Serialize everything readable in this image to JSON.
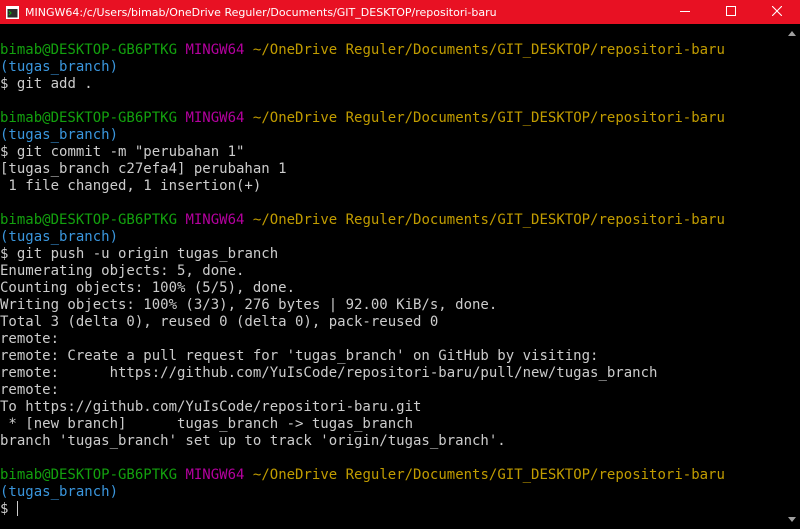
{
  "window": {
    "title": "MINGW64:/c/Users/bimab/OneDrive Reguler/Documents/GIT_DESKTOP/repositori-baru",
    "icon": "mingw-terminal-icon",
    "controls": [
      "minimize-icon",
      "maximize-icon",
      "close-icon"
    ]
  },
  "colors": {
    "titlebar": "#e81123",
    "background": "#000000",
    "text": "#cccccc",
    "user": "#13a10e",
    "system": "#b4009e",
    "path": "#c19c00",
    "branch": "#3a96dd"
  },
  "prompt": {
    "user": "bimab@DESKTOP-GB6PTKG",
    "system": "MINGW64",
    "path": "~/OneDrive Reguler/Documents/GIT_DESKTOP/repositori-baru",
    "branch": "(tugas_branch)",
    "symbol": "$"
  },
  "blocks": [
    {
      "command": "git add .",
      "output": []
    },
    {
      "command": "git commit -m \"perubahan 1\"",
      "output": [
        "[tugas_branch c27efa4] perubahan 1",
        " 1 file changed, 1 insertion(+)"
      ]
    },
    {
      "command": "git push -u origin tugas_branch",
      "output": [
        "Enumerating objects: 5, done.",
        "Counting objects: 100% (5/5), done.",
        "Writing objects: 100% (3/3), 276 bytes | 92.00 KiB/s, done.",
        "Total 3 (delta 0), reused 0 (delta 0), pack-reused 0",
        "remote:",
        "remote: Create a pull request for 'tugas_branch' on GitHub by visiting:",
        "remote:      https://github.com/YuIsCode/repositori-baru/pull/new/tugas_branch",
        "remote:",
        "To https://github.com/YuIsCode/repositori-baru.git",
        " * [new branch]      tugas_branch -> tugas_branch",
        "branch 'tugas_branch' set up to track 'origin/tugas_branch'."
      ]
    },
    {
      "command": "",
      "output": []
    }
  ]
}
